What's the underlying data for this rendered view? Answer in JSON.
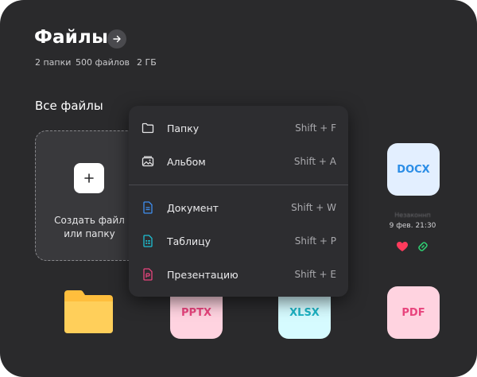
{
  "header": {
    "title": "Файлы",
    "meta": {
      "folders": "2 папки",
      "files": "500 файлов",
      "size": "2 ГБ"
    }
  },
  "section": {
    "title": "Все файлы"
  },
  "create": {
    "line1": "Создать файл",
    "line2": "или папку"
  },
  "menu": {
    "items": [
      {
        "label": "Папку",
        "shortcut": "Shift + F",
        "icon": "folder-icon"
      },
      {
        "label": "Альбом",
        "shortcut": "Shift + A",
        "icon": "album-icon"
      },
      {
        "label": "Документ",
        "shortcut": "Shift + W",
        "icon": "document-icon"
      },
      {
        "label": "Таблицу",
        "shortcut": "Shift + P",
        "icon": "table-icon"
      },
      {
        "label": "Презентацию",
        "shortcut": "Shift + E",
        "icon": "presentation-icon"
      }
    ]
  },
  "files": {
    "docx": {
      "label": "DOCX",
      "faded_name": "Незаконнп",
      "date": "9 фев. 21:30"
    },
    "pptx": {
      "label": "PPTX"
    },
    "xlsx": {
      "label": "XLSX"
    },
    "pdf": {
      "label": "PDF"
    }
  },
  "colors": {
    "panel_bg": "#2a2a2c",
    "menu_bg": "#2d2d30",
    "docx_bg": "#e3efff",
    "docx_text": "#2b8de6",
    "pptx_bg": "#ffd3e0",
    "pptx_text": "#e8447d",
    "xlsx_bg": "#d6fbff",
    "xlsx_text": "#1bb3c4",
    "pdf_bg": "#ffd3e0",
    "pdf_text": "#e8447d",
    "folder": "#ffbe3d",
    "heart": "#ff3b5c",
    "link": "#2ecc71"
  }
}
